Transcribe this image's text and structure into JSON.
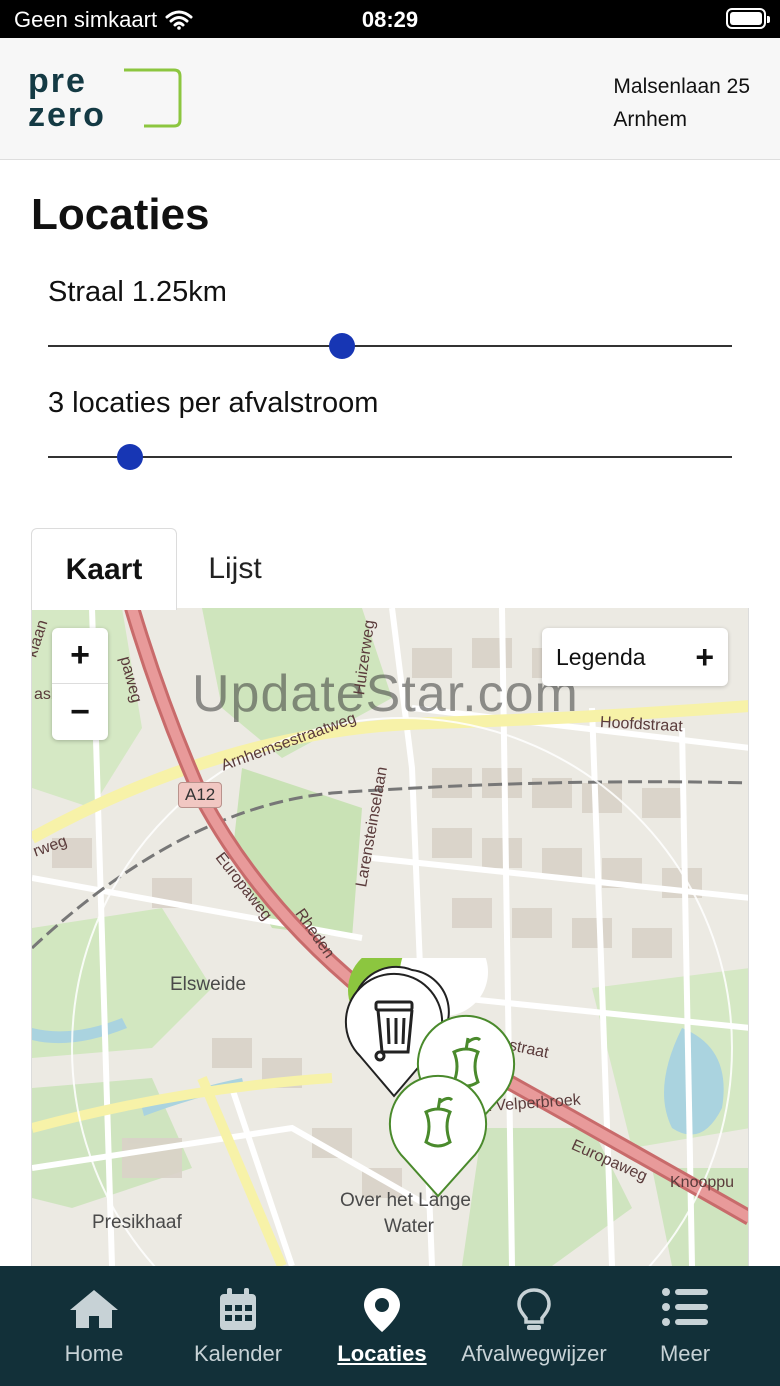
{
  "status_bar": {
    "carrier": "Geen simkaart",
    "time": "08:29"
  },
  "header": {
    "logo": {
      "line1": "pre",
      "line2": "zero"
    },
    "address_line1": "Malsenlaan 25",
    "address_line2": "Arnhem"
  },
  "page_title": "Locaties",
  "radius_slider": {
    "label": "Straal 1.25km",
    "value_fraction": 0.43
  },
  "count_slider": {
    "label": "3 locaties per afvalstroom",
    "value_fraction": 0.12
  },
  "tabs": [
    {
      "label": "Kaart",
      "active": true
    },
    {
      "label": "Lijst",
      "active": false
    }
  ],
  "map": {
    "zoom_in": "+",
    "zoom_out": "−",
    "legend_label": "Legenda",
    "legend_toggle": "+",
    "watermark": "UpdateStar.com",
    "labels": {
      "elsweide": "Elsweide",
      "presikhaaf": "Presikhaaf",
      "over_het_lange": "Over het Lange",
      "water": "Water",
      "a12": "A12",
      "europaweg_1": "Europaweg",
      "europaweg_2": "Europaweg",
      "arnhemsestraatweg": "Arnhemsestraatweg",
      "hoofdstraat": "Hoofdstraat",
      "waterstraat": "Waterstraat",
      "velperbroek": "punt Velperbroek",
      "rheden": "Rheden",
      "arensteinselaan": "Larensteinselaan",
      "huizerweg": "Huizerweg",
      "knooppunt": "Knooppu",
      "asberg": "asberg",
      "klaan": "klaan",
      "rweg": "rweg",
      "paweg": "paweg"
    },
    "marker_icons": [
      "bin-icon",
      "bin-icon",
      "apple-core-icon",
      "apple-core-icon"
    ],
    "accent_green": "#4a8a2c",
    "marker_highlight": "#8cc63f"
  },
  "bottom_nav": [
    {
      "label": "Home",
      "icon": "home-icon",
      "active": false
    },
    {
      "label": "Kalender",
      "icon": "calendar-icon",
      "active": false
    },
    {
      "label": "Locaties",
      "icon": "location-pin-icon",
      "active": true
    },
    {
      "label": "Afvalwegwijzer",
      "icon": "lightbulb-icon",
      "active": false
    },
    {
      "label": "Meer",
      "icon": "list-icon",
      "active": false
    }
  ],
  "colors": {
    "slider_thumb": "#1736b4",
    "nav_background": "#123039",
    "logo_dark": "#143a44",
    "logo_green": "#8cc63f"
  }
}
